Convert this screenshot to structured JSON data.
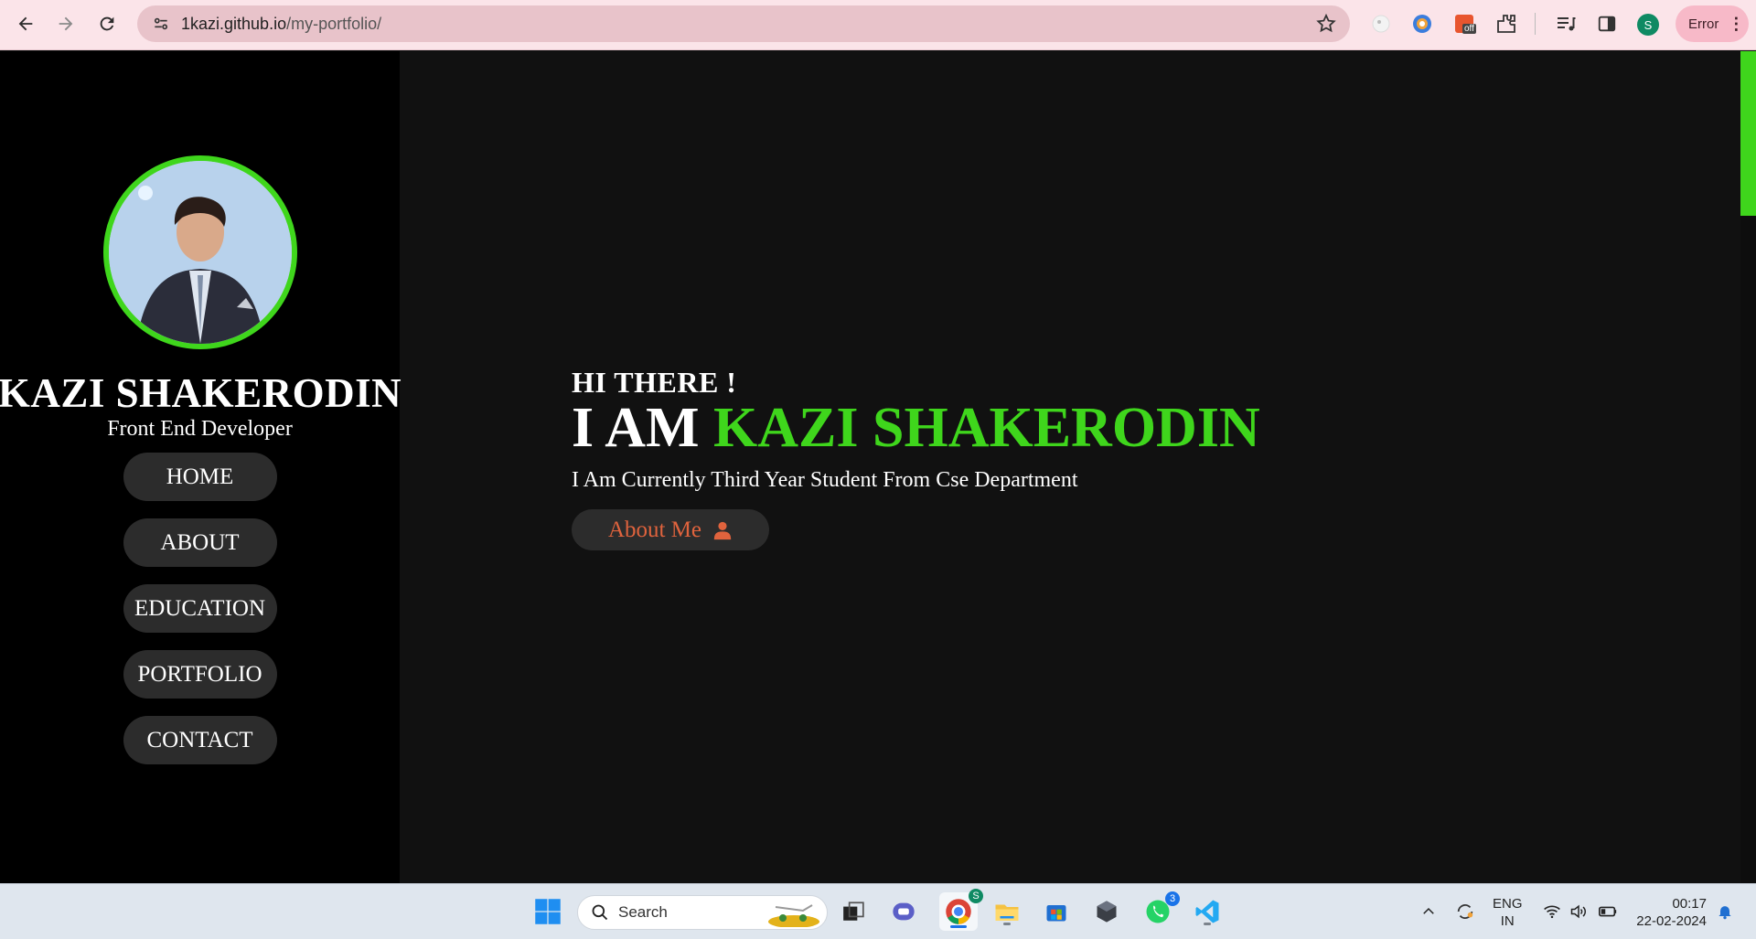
{
  "browser": {
    "url_host": "1kazi.github.io",
    "url_path": "/my-portfolio/",
    "profile_initial": "S",
    "error_label": "Error",
    "ext_badge": "off"
  },
  "sidebar": {
    "name": "KAZI SHAKERODIN",
    "role": "Front End Developer",
    "nav": [
      {
        "label": "HOME"
      },
      {
        "label": "ABOUT"
      },
      {
        "label": "EDUCATION"
      },
      {
        "label": "PORTFOLIO"
      },
      {
        "label": "CONTACT"
      }
    ]
  },
  "hero": {
    "greeting": "HI THERE !",
    "iam": "I AM",
    "name": "KAZI SHAKERODIN",
    "description": "I Am Currently Third Year Student From Cse Department",
    "button_label": "About Me"
  },
  "taskbar": {
    "search_label": "Search",
    "chrome_badge": "S",
    "whatsapp_badge": "3",
    "lang_line1": "ENG",
    "lang_line2": "IN",
    "time": "00:17",
    "date": "22-02-2024"
  },
  "colors": {
    "accent": "#3fd61c",
    "button_text": "#e0633d",
    "chrome_bar": "#fbe4e9"
  }
}
